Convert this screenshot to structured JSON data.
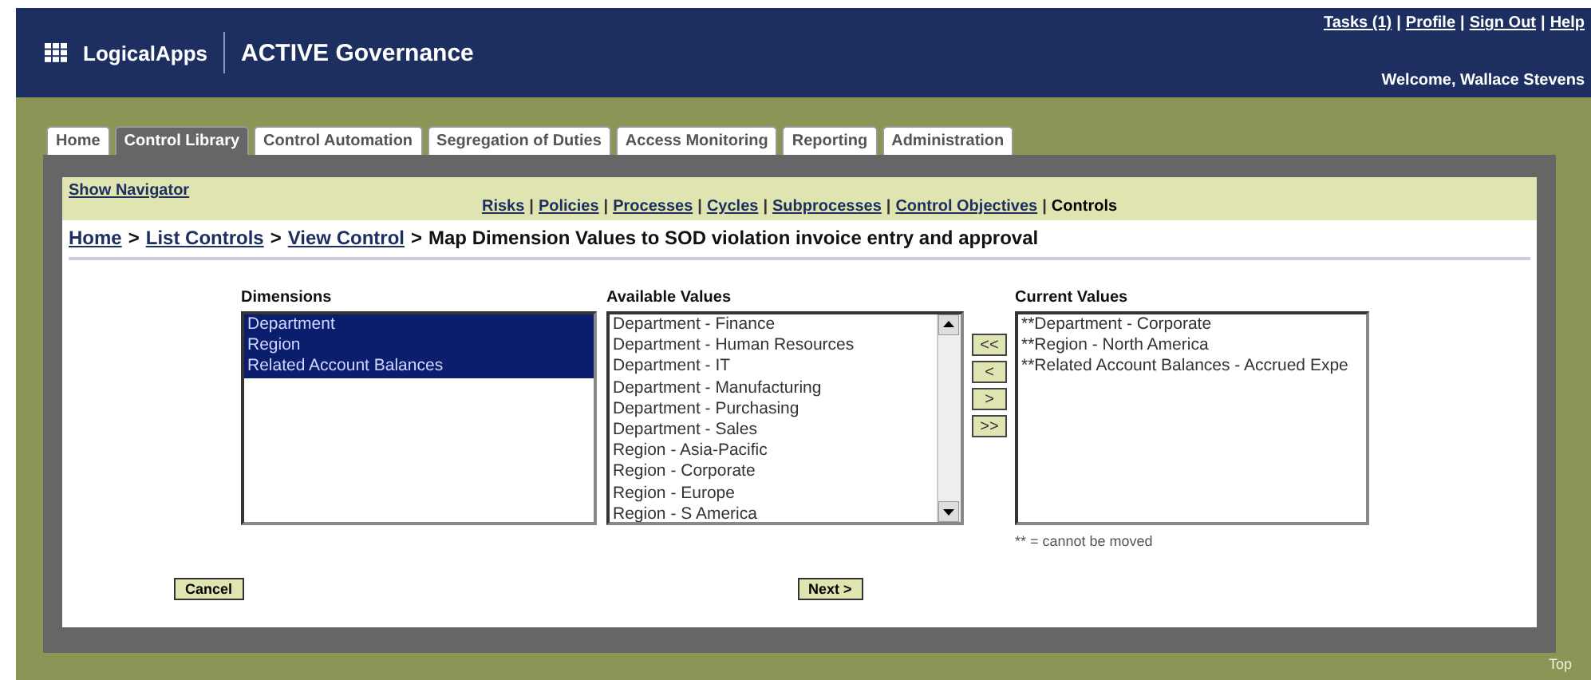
{
  "header": {
    "logo": "LogicalApps",
    "product": "ACTIVE Governance",
    "links": [
      "Tasks (1)",
      "Profile",
      "Sign Out",
      "Help"
    ],
    "separators": [
      "|",
      "|",
      "|"
    ],
    "welcome": "Welcome, Wallace Stevens"
  },
  "tabs": [
    {
      "label": "Home",
      "selected": false
    },
    {
      "label": "Control Library",
      "selected": true
    },
    {
      "label": "Control Automation",
      "selected": false
    },
    {
      "label": "Segregation of Duties",
      "selected": false
    },
    {
      "label": "Access Monitoring",
      "selected": false
    },
    {
      "label": "Reporting",
      "selected": false
    },
    {
      "label": "Administration",
      "selected": false
    }
  ],
  "navigator": "Show Navigator",
  "subnav": [
    {
      "label": "Risks",
      "selected": false
    },
    {
      "label": "Policies",
      "selected": false
    },
    {
      "label": "Processes",
      "selected": false
    },
    {
      "label": "Cycles",
      "selected": false
    },
    {
      "label": "Subprocesses",
      "selected": false
    },
    {
      "label": "Control Objectives",
      "selected": false
    },
    {
      "label": "Controls",
      "selected": true
    }
  ],
  "subnav_separators": [
    "|",
    "|",
    "|",
    "|",
    "|",
    "|"
  ],
  "breadcrumb": {
    "links": [
      "Home",
      "List Controls",
      "View Control"
    ],
    "separators": [
      ">",
      ">",
      ">"
    ],
    "current": "Map Dimension Values to SOD violation invoice entry and approval"
  },
  "dimensions": {
    "title": "Dimensions",
    "items": [
      {
        "label": "Department",
        "selected": true
      },
      {
        "label": "Region",
        "selected": true
      },
      {
        "label": "Related Account Balances",
        "selected": true
      }
    ]
  },
  "available": {
    "title": "Available Values",
    "items": [
      {
        "label": "Department - Finance",
        "selected": false
      },
      {
        "label": "Department - Human Resources",
        "selected": false
      },
      {
        "label": "Department - IT",
        "selected": false
      },
      {
        "label": "Department - Manufacturing",
        "selected": false
      },
      {
        "label": "Department - Purchasing",
        "selected": false
      },
      {
        "label": "Department - Sales",
        "selected": false
      },
      {
        "label": "Region - Asia-Pacific",
        "selected": false
      },
      {
        "label": "Region - Corporate",
        "selected": false
      },
      {
        "label": "Region - Europe",
        "selected": false
      },
      {
        "label": "Region - S America",
        "selected": false
      }
    ]
  },
  "move_buttons": [
    "<<",
    "<",
    ">",
    ">>"
  ],
  "current": {
    "title": "Current Values",
    "items": [
      {
        "label": "**Department - Corporate",
        "selected": false
      },
      {
        "label": "**Region - North America",
        "selected": false
      },
      {
        "label": "**Related Account Balances - Accrued Expe",
        "selected": false
      }
    ],
    "note": "** = cannot be moved"
  },
  "buttons": {
    "cancel": "Cancel",
    "next": "Next >"
  },
  "footer_link": "Top"
}
